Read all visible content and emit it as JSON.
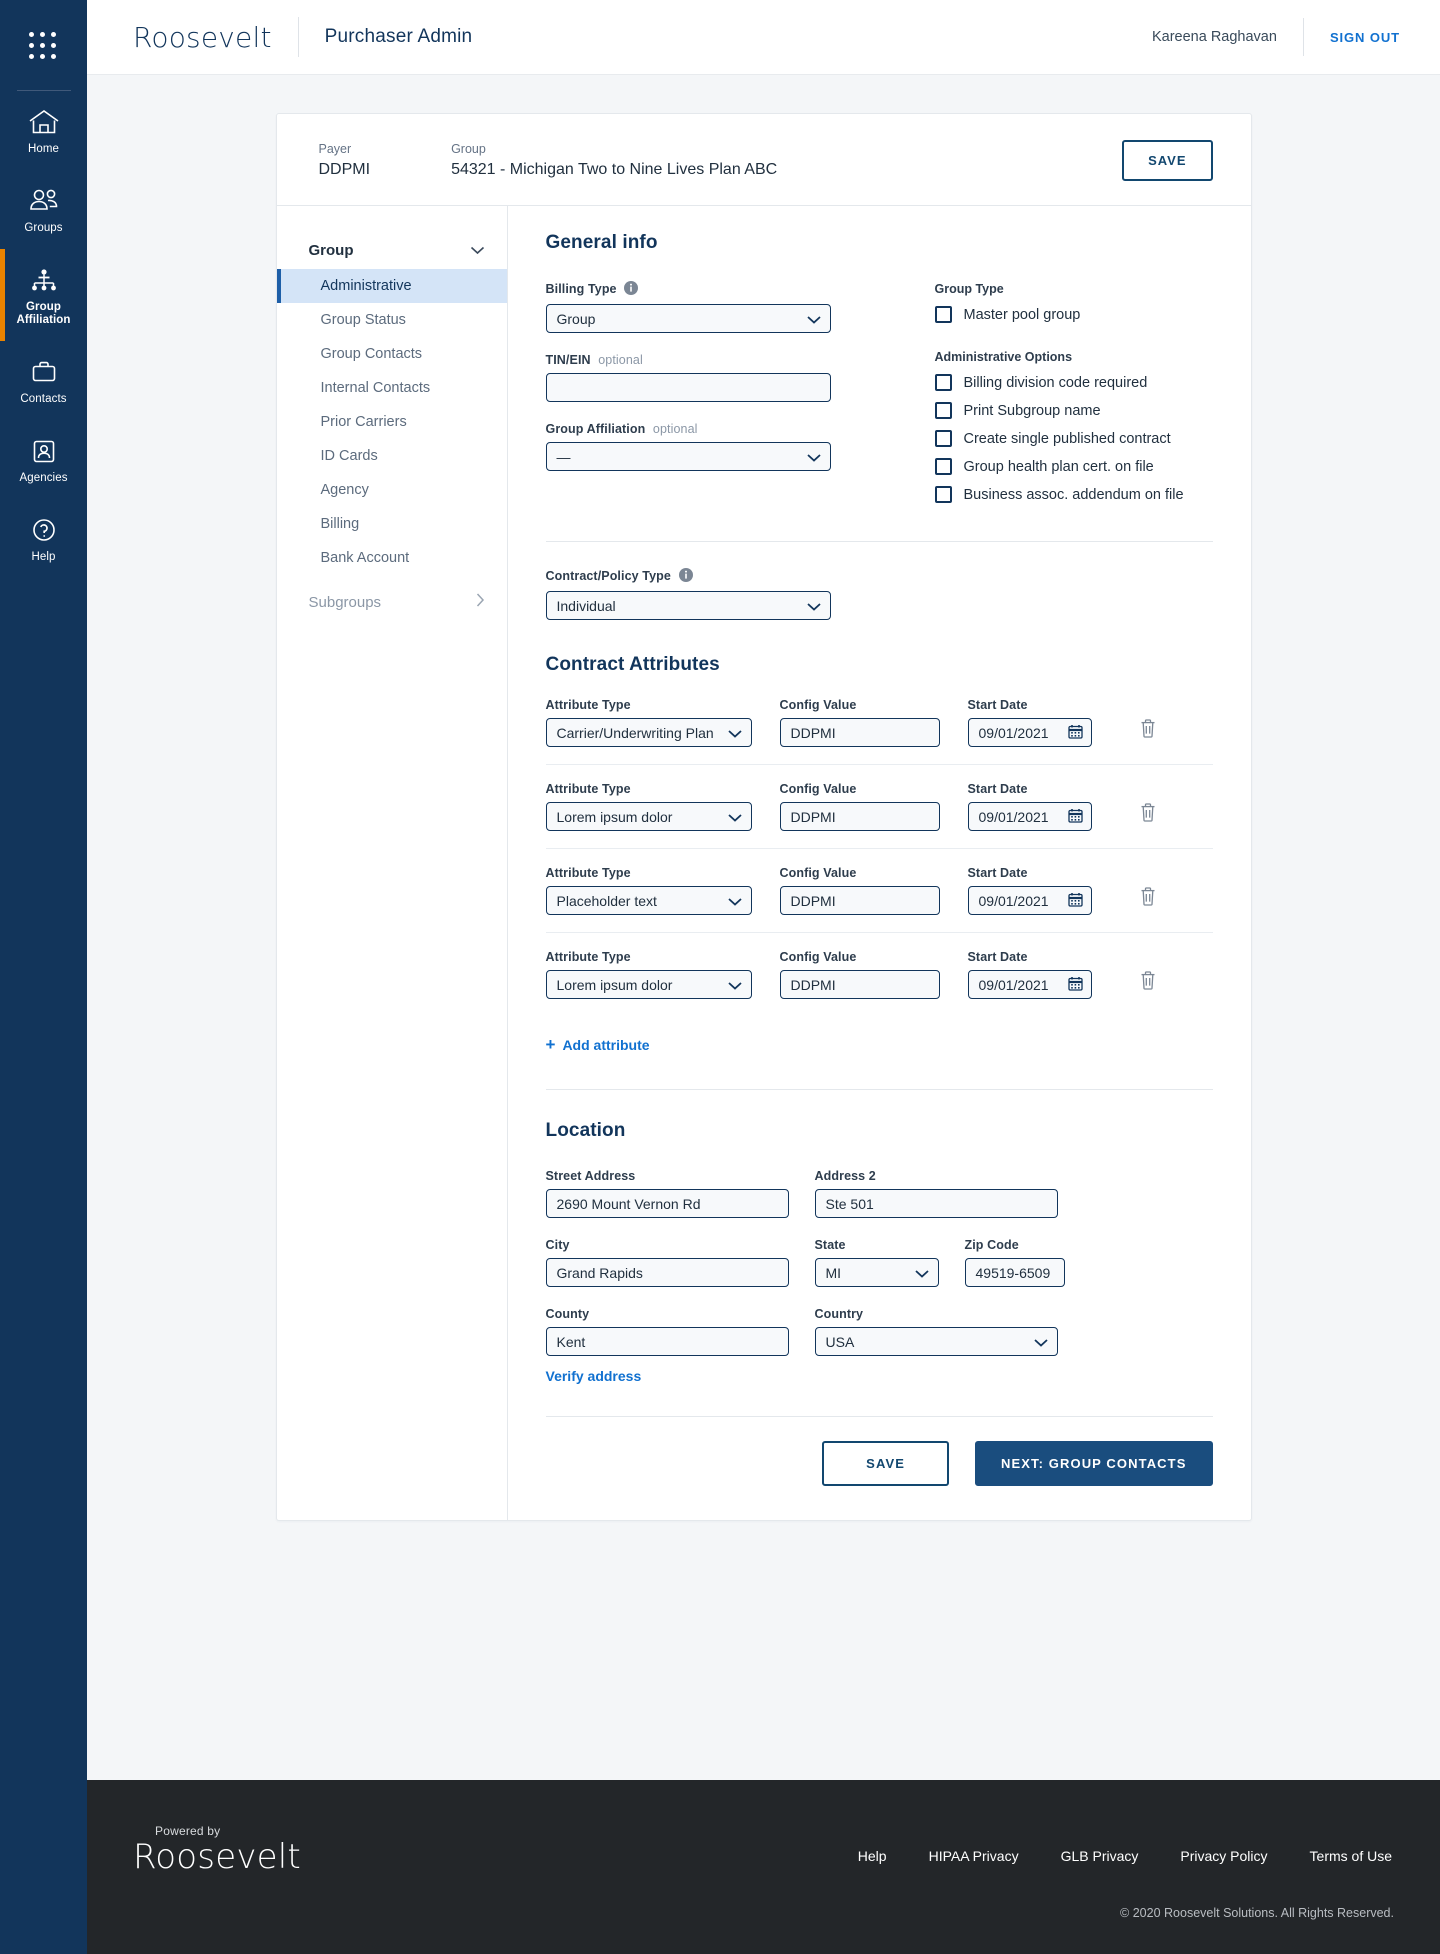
{
  "rail": {
    "apps_icon": "grid-apps-icon",
    "items": [
      {
        "label": "Home",
        "icon": "home-icon",
        "active": false
      },
      {
        "label": "Groups",
        "icon": "people-icon",
        "active": false
      },
      {
        "label": "Group Affiliation",
        "icon": "org-chart-icon",
        "active": true
      },
      {
        "label": "Contacts",
        "icon": "briefcase-icon",
        "active": false
      },
      {
        "label": "Agencies",
        "icon": "id-badge-icon",
        "active": false
      },
      {
        "label": "Help",
        "icon": "question-circle-icon",
        "active": false
      }
    ]
  },
  "header": {
    "brand": "Roosevelt",
    "app_title": "Purchaser Admin",
    "user_name": "Kareena Raghavan",
    "sign_out": "SIGN OUT"
  },
  "card_head": {
    "payer_label": "Payer",
    "payer_value": "DDPMI",
    "group_label": "Group",
    "group_value": "54321 - Michigan Two to Nine Lives Plan ABC",
    "save_label": "SAVE"
  },
  "subnav": {
    "title": "Group",
    "items": [
      {
        "label": "Administrative",
        "active": true
      },
      {
        "label": "Group Status",
        "active": false
      },
      {
        "label": "Group Contacts",
        "active": false
      },
      {
        "label": "Internal Contacts",
        "active": false
      },
      {
        "label": "Prior Carriers",
        "active": false
      },
      {
        "label": "ID Cards",
        "active": false
      },
      {
        "label": "Agency",
        "active": false
      },
      {
        "label": "Billing",
        "active": false
      },
      {
        "label": "Bank Account",
        "active": false
      }
    ],
    "footer_item": "Subgroups"
  },
  "general": {
    "heading": "General info",
    "billing_type_label": "Billing Type",
    "billing_type_value": "Group",
    "tin_label": "TIN/EIN",
    "tin_optional": "optional",
    "tin_value": "",
    "group_affiliation_label": "Group Affiliation",
    "group_affiliation_optional": "optional",
    "group_affiliation_value": "—",
    "group_type_label": "Group Type",
    "group_type_options": [
      {
        "label": "Master pool group",
        "checked": false
      }
    ],
    "admin_options_label": "Administrative Options",
    "admin_options": [
      {
        "label": "Billing division code required",
        "checked": false
      },
      {
        "label": "Print Subgroup name",
        "checked": false
      },
      {
        "label": "Create single published contract",
        "checked": false
      },
      {
        "label": "Group health plan cert. on file",
        "checked": false
      },
      {
        "label": "Business assoc. addendum on file",
        "checked": false
      }
    ]
  },
  "contract": {
    "policy_type_label": "Contract/Policy Type",
    "policy_type_value": "Individual",
    "attributes_heading": "Contract Attributes",
    "col_attribute_type": "Attribute Type",
    "col_config_value": "Config Value",
    "col_start_date": "Start Date",
    "rows": [
      {
        "attribute_type": "Carrier/Underwriting Plan",
        "config_value": "DDPMI",
        "start_date": "09/01/2021"
      },
      {
        "attribute_type": "Lorem ipsum dolor",
        "config_value": "DDPMI",
        "start_date": "09/01/2021"
      },
      {
        "attribute_type": "Placeholder text",
        "config_value": "DDPMI",
        "start_date": "09/01/2021"
      },
      {
        "attribute_type": "Lorem ipsum dolor",
        "config_value": "DDPMI",
        "start_date": "09/01/2021"
      }
    ],
    "add_attribute": "Add attribute",
    "add_plus": "+"
  },
  "location": {
    "heading": "Location",
    "street_label": "Street Address",
    "street_value": "2690 Mount Vernon Rd",
    "address2_label": "Address 2",
    "address2_value": "Ste 501",
    "city_label": "City",
    "city_value": "Grand Rapids",
    "state_label": "State",
    "state_value": "MI",
    "zip_label": "Zip Code",
    "zip_value": "49519-6509",
    "county_label": "County",
    "county_value": "Kent",
    "country_label": "Country",
    "country_value": "USA",
    "verify_address": "Verify address"
  },
  "actions": {
    "save": "SAVE",
    "next": "NEXT: GROUP CONTACTS"
  },
  "footer": {
    "powered_by": "Powered by",
    "brand": "Roosevelt",
    "links": [
      "Help",
      "HIPAA Privacy",
      "GLB Privacy",
      "Privacy Policy",
      "Terms of Use"
    ],
    "copyright": "© 2020 Roosevelt Solutions. All Rights Reserved."
  },
  "colors": {
    "rail_bg": "#12355b",
    "accent_orange": "#e98300",
    "link_blue": "#1171d0",
    "primary_btn": "#1a4d7e",
    "active_subnav": "#d4e4f7",
    "footer_bg": "#232629"
  }
}
